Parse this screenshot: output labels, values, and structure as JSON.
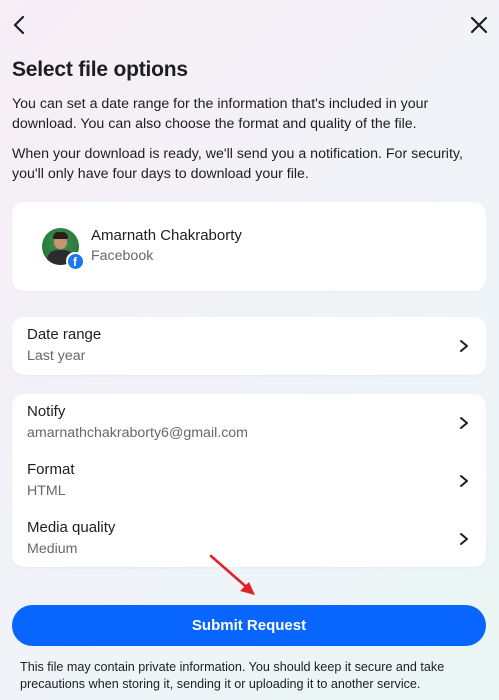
{
  "header": {
    "title": "Select file options",
    "back_icon": "chevron-left-icon",
    "close_icon": "close-icon"
  },
  "intro": {
    "paragraph1": "You can set a date range for the information that's included in your download. You can also choose the format and quality of the file.",
    "paragraph2": "When your download is ready, we'll send you a notification. For security, you'll only have four days to download your file."
  },
  "account": {
    "name": "Amarnath Chakraborty",
    "platform": "Facebook",
    "badge_letter": "f"
  },
  "options": {
    "date_range": {
      "label": "Date range",
      "value": "Last year"
    },
    "notify": {
      "label": "Notify",
      "value": "amarnathchakraborty6@gmail.com"
    },
    "format": {
      "label": "Format",
      "value": "HTML"
    },
    "media_quality": {
      "label": "Media quality",
      "value": "Medium"
    }
  },
  "submit_label": "Submit Request",
  "footer_note": "This file may contain private information. You should keep it secure and take precautions when storing it, sending it or uploading it to another service.",
  "colors": {
    "primary": "#0866ff",
    "facebook_blue": "#1877f2",
    "annotation_arrow": "#e0202a",
    "secondary_text": "#65676b"
  }
}
